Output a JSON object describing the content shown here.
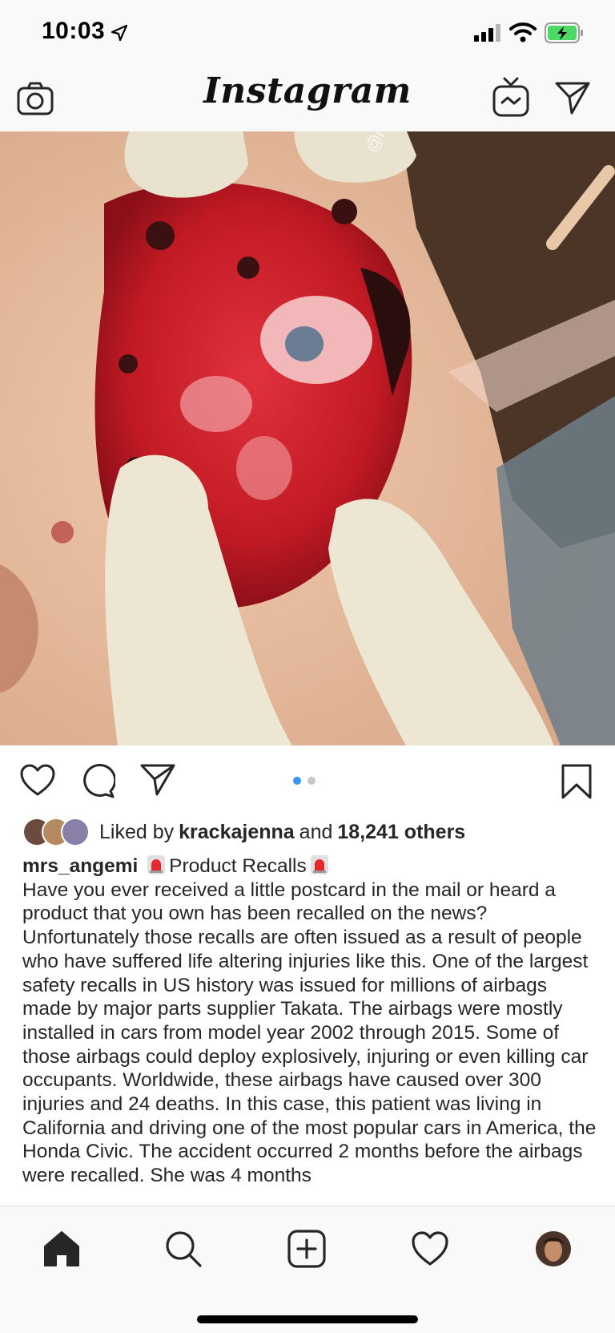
{
  "status_bar": {
    "time": "10:03"
  },
  "header": {
    "logo": "Instagram"
  },
  "post": {
    "carousel": {
      "count": 2,
      "active_index": 0
    },
    "likes": {
      "prefix": "Liked by",
      "user": "krackajenna",
      "joiner": "and",
      "others": "18,241 others"
    },
    "caption": {
      "username": "mrs_angemi",
      "title": "Product Recalls",
      "body": "Have you ever received a little postcard in the mail or heard a product that you own has been recalled on the news? Unfortunately those recalls are often issued as a result of people who have suffered life altering injuries like this. One of the largest safety recalls in US history was issued for millions of airbags made by major parts supplier Takata. The airbags were mostly installed in cars from model year 2002 through 2015. Some of those airbags could deploy explosively, injuring or even killing car occupants. Worldwide, these airbags have caused over 300 injuries and 24 deaths. In this case, this patient was living in California and driving one of the most popular cars in America, the Honda Civic. The accident occurred 2 months before the airbags were recalled. She was 4 months"
    }
  },
  "icons": {
    "status": [
      "location-arrow-icon",
      "signal-icon",
      "wifi-icon",
      "battery-icon"
    ],
    "header": [
      "camera-icon",
      "igtv-icon",
      "direct-message-icon"
    ],
    "actions": [
      "heart-icon",
      "comment-icon",
      "share-icon",
      "bookmark-icon"
    ],
    "tabs": [
      "home-icon",
      "search-icon",
      "new-post-icon",
      "activity-heart-icon",
      "profile-avatar-icon"
    ]
  },
  "colors": {
    "accent_blue": "#3897f0",
    "battery_green": "#4cd964",
    "text": "#262626"
  }
}
